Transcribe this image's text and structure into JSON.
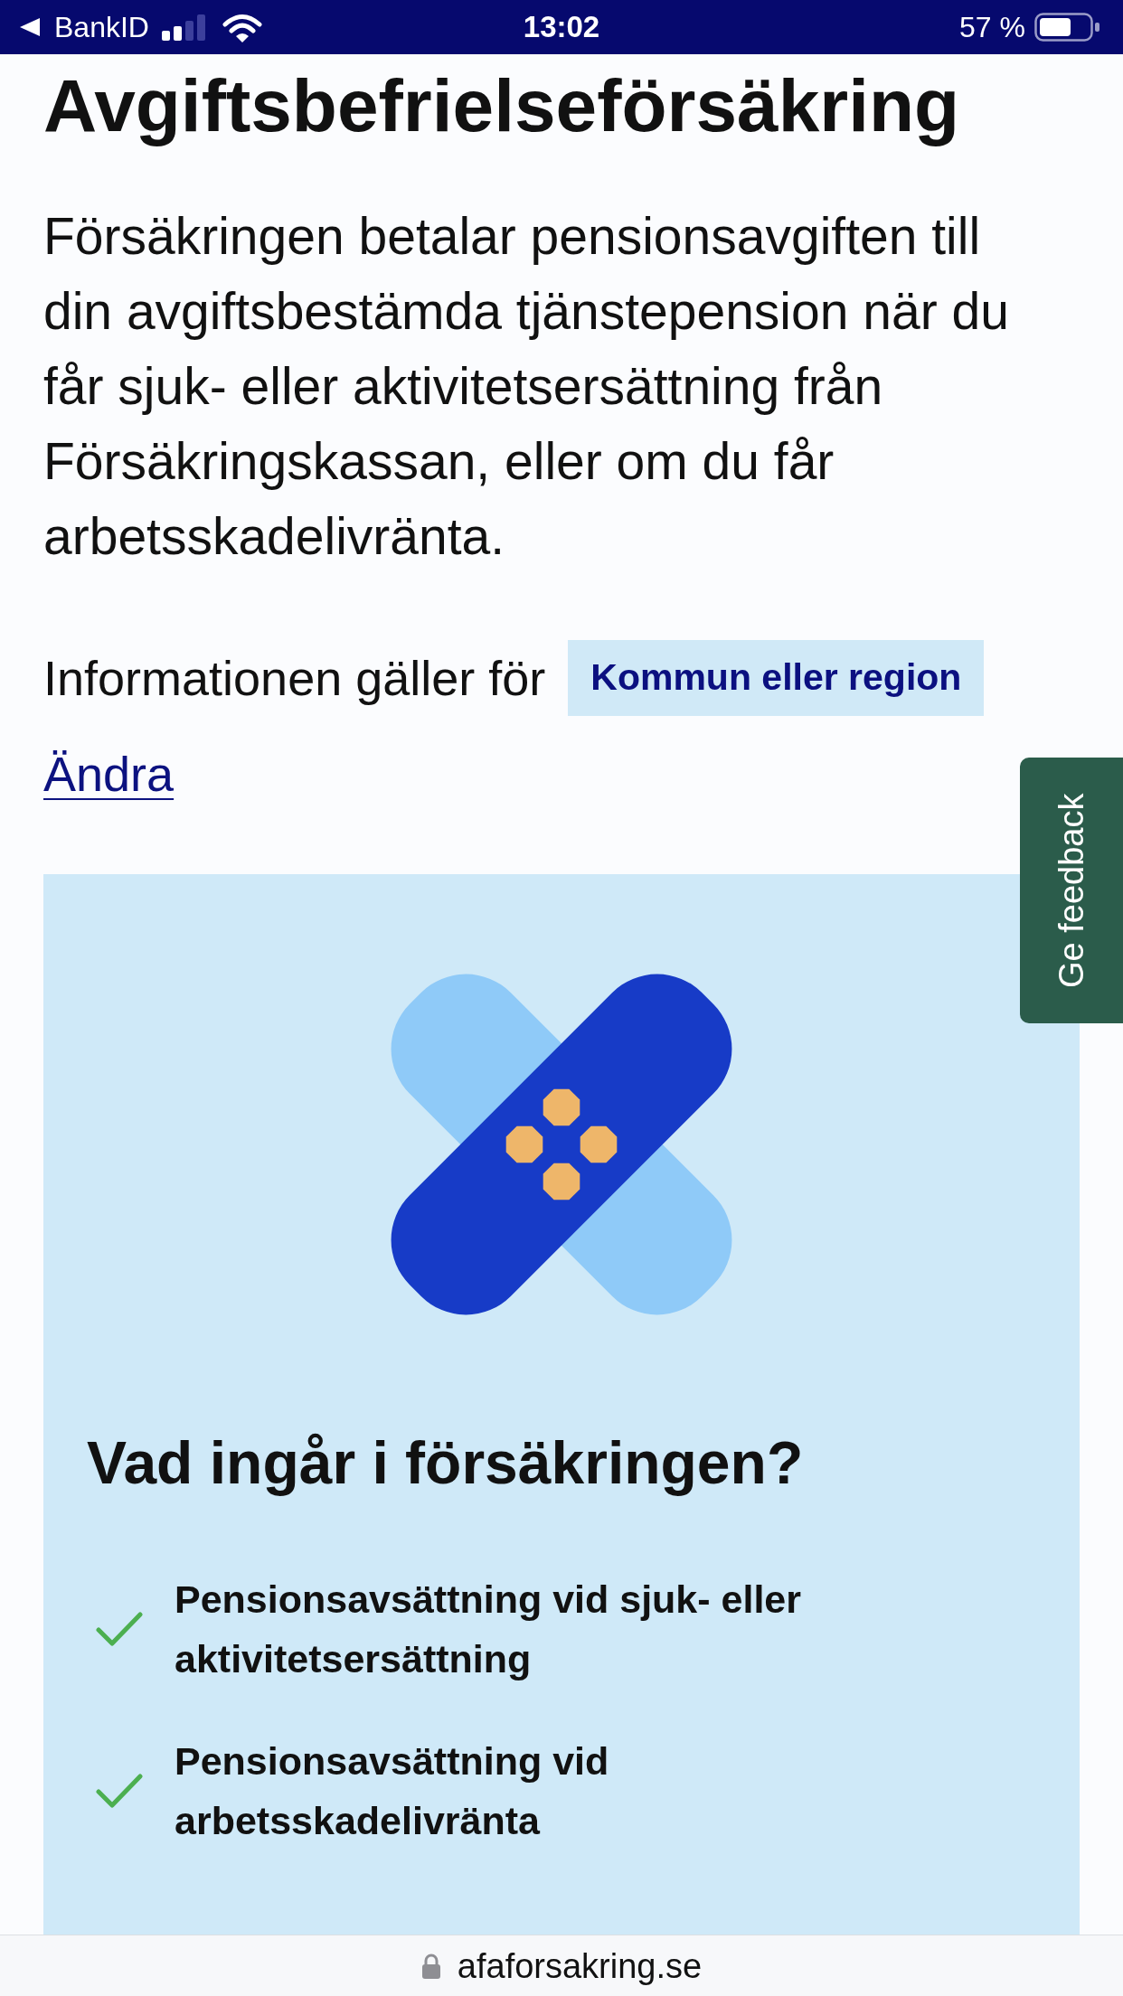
{
  "status_bar": {
    "back_link": "BankID",
    "time": "13:02",
    "battery": "57 %"
  },
  "title": "Avgiftsbefrielseförsäkring",
  "intro": "Försäkringen betalar pensionsavgiften till din avgiftsbestämda tjänstepension när du får sjuk- eller aktivitetsersättning från Försäkringskassan, eller om du får arbetsskadelivränta.",
  "audience": {
    "label": "Informationen gäller för",
    "tag": "Kommun eller region",
    "change_link": "Ändra"
  },
  "feedback_tab": {
    "label": "Ge feedback"
  },
  "coverage": {
    "heading": "Vad ingår i försäkringen?",
    "items": [
      {
        "text": "Pensionsavsättning vid sjuk- eller aktivitetsersättning"
      },
      {
        "text": "Pensionsavsättning vid arbetsskadelivränta"
      }
    ]
  },
  "address_bar": {
    "url": "afaforsakring.se"
  }
}
